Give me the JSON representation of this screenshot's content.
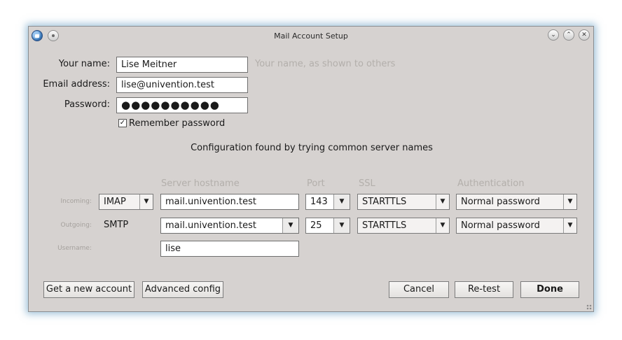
{
  "window": {
    "title": "Mail Account Setup"
  },
  "identity": {
    "name_label": "Your name:",
    "name_value": "Lise Meitner",
    "name_hint": "Your name, as shown to others",
    "email_label": "Email address:",
    "email_value": "lise@univention.test",
    "password_label": "Password:",
    "password_mask": "●●●●●●●●●●",
    "remember_label": "Remember password",
    "remember_checked": true
  },
  "status_message": "Configuration found by trying common server names",
  "server_table": {
    "headers": {
      "hostname": "Server hostname",
      "port": "Port",
      "ssl": "SSL",
      "auth": "Authentication"
    },
    "incoming": {
      "label": "Incoming:",
      "protocol": "IMAP",
      "hostname": "mail.univention.test",
      "port": "143",
      "ssl": "STARTTLS",
      "auth": "Normal password"
    },
    "outgoing": {
      "label": "Outgoing:",
      "protocol": "SMTP",
      "hostname": "mail.univention.test",
      "port": "25",
      "ssl": "STARTTLS",
      "auth": "Normal password"
    },
    "username": {
      "label": "Username:",
      "value": "lise"
    }
  },
  "buttons": {
    "get_account": "Get a new account",
    "advanced": "Advanced config",
    "cancel": "Cancel",
    "retest": "Re-test",
    "done": "Done"
  }
}
